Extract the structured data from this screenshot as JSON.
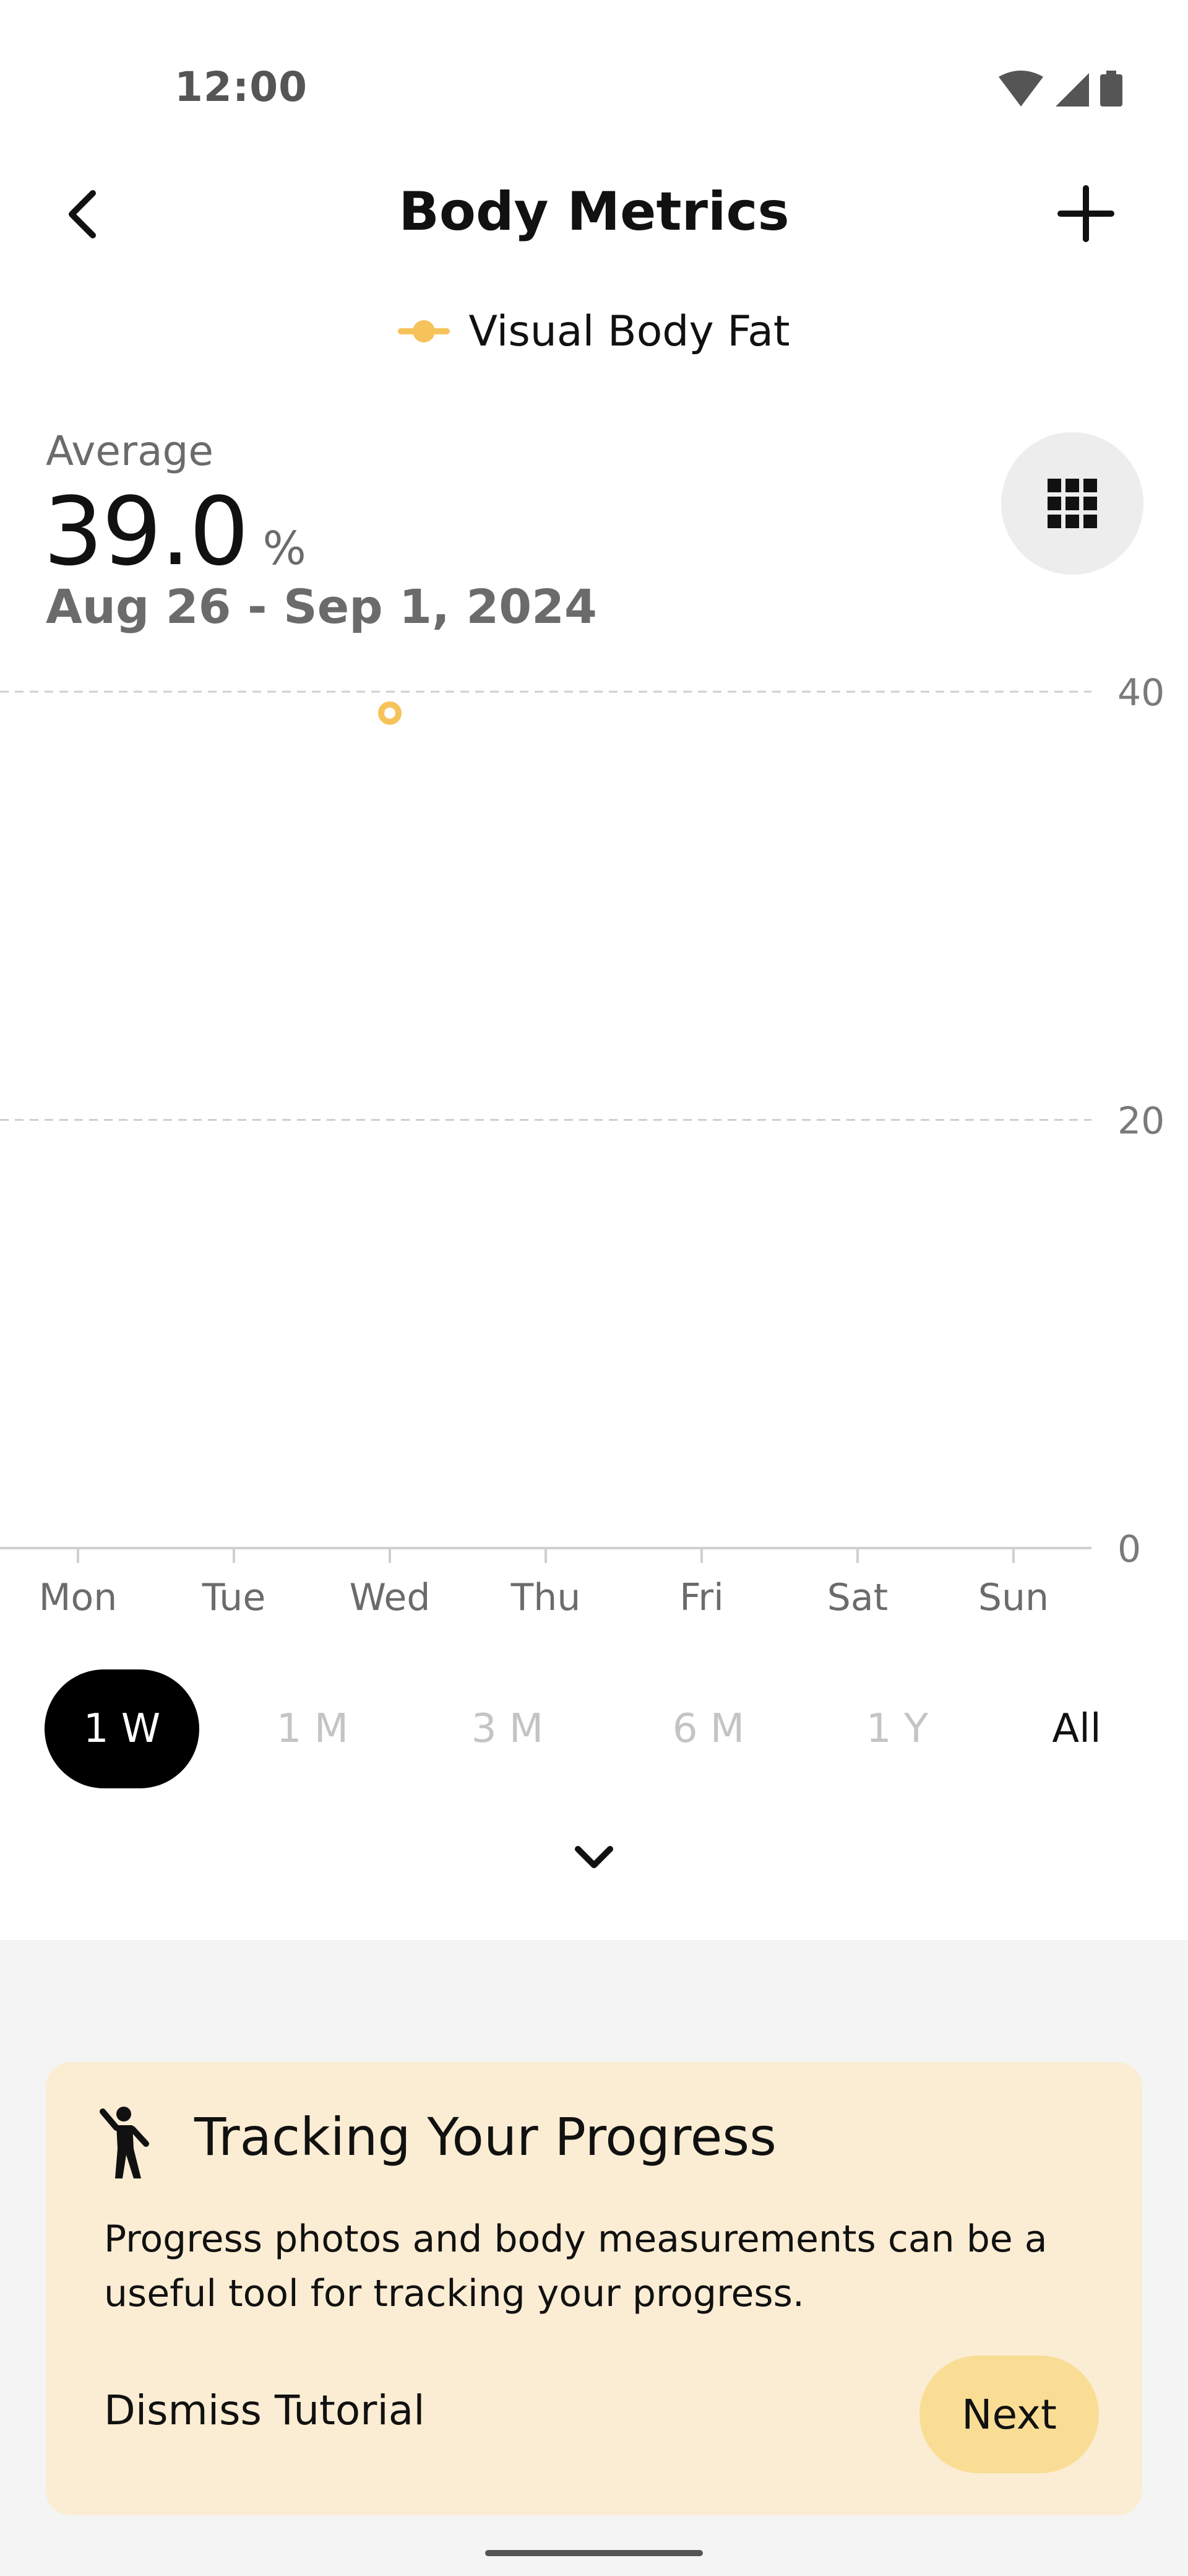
{
  "status_bar": {
    "time": "12:00",
    "icons": [
      "wifi-icon",
      "cellular-signal-icon",
      "battery-icon"
    ]
  },
  "app_bar": {
    "title": "Body Metrics",
    "back_icon": "chevron-left-icon",
    "add_icon": "plus-icon"
  },
  "legend": {
    "label": "Visual Body Fat",
    "color": "#f6c35a"
  },
  "summary": {
    "label": "Average",
    "value": "39.0",
    "unit": "%",
    "date_range": "Aug 26 - Sep 1, 2024",
    "grid_icon": "grid-icon"
  },
  "chart_data": {
    "type": "scatter",
    "categories": [
      "Mon",
      "Tue",
      "Wed",
      "Thu",
      "Fri",
      "Sat",
      "Sun"
    ],
    "series": [
      {
        "name": "Visual Body Fat",
        "color": "#f6c35a",
        "points": [
          {
            "x": "Wed",
            "y": 39.0
          }
        ]
      }
    ],
    "ylim": [
      0,
      40
    ],
    "yticks": [
      0,
      20,
      40
    ],
    "ytick_labels": [
      "0",
      "20",
      "40"
    ],
    "grid": "dashed horizontal",
    "y_axis_position": "right"
  },
  "range_selector": {
    "options": [
      "1 W",
      "1 M",
      "3 M",
      "6 M",
      "1 Y",
      "All"
    ],
    "selected": "1 W"
  },
  "expand_icon": "chevron-down-icon",
  "tutorial": {
    "icon": "person-walking-icon",
    "title": "Tracking Your Progress",
    "body": "Progress photos and body measurements can be a useful tool for tracking your progress.",
    "dismiss_label": "Dismiss Tutorial",
    "next_label": "Next"
  },
  "colors": {
    "accent": "#f6c35a",
    "card": "#fbedd3",
    "next_button": "#f9dd95",
    "selected_chip": "#000000"
  }
}
